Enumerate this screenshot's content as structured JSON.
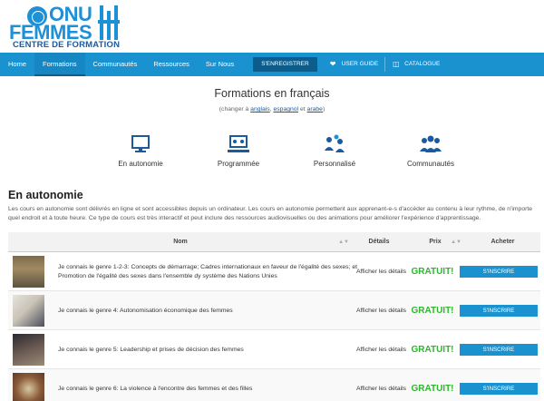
{
  "logo": {
    "line1": "ONU",
    "line2": "FEMMES",
    "sub": "CENTRE DE FORMATION"
  },
  "nav": {
    "items": [
      "Home",
      "Formations",
      "Communautés",
      "Ressources",
      "Sur Nous"
    ],
    "register": "S'ENREGISTRER",
    "user_guide": "USER GUIDE",
    "catalogue": "CATALOGUE"
  },
  "page": {
    "title": "Formations en français",
    "subtitle_prefix": "(changer à ",
    "lang1": "anglais",
    "sep1": ", ",
    "lang2": "espagnol",
    "sep2": " et ",
    "lang3": "arabe",
    "subtitle_suffix": ")"
  },
  "categories": [
    {
      "label": "En autonomie",
      "icon": "monitor-icon"
    },
    {
      "label": "Programmée",
      "icon": "presentation-icon"
    },
    {
      "label": "Personnalisé",
      "icon": "people-chat-icon"
    },
    {
      "label": "Communautés",
      "icon": "group-icon"
    }
  ],
  "section": {
    "title": "En autonomie",
    "description": "Les cours en autonomie sont délivrés en ligne et sont accessibles depuis un ordinateur. Les cours en autonomie permettent aux apprenant-e-s d'accéder au contenu à leur rythme, de n'importe quel endroit et à toute heure. Ce type de cours est très interactif et peut inclure des ressources audiovisuelles ou des animations pour améliorer l'expérience d'apprentissage."
  },
  "table": {
    "headers": {
      "name": "Nom",
      "details": "Détails",
      "price": "Prix",
      "buy": "Acheter"
    },
    "rows": [
      {
        "name": "Je connais le genre 1-2-3: Concepts de démarrage; Cadres internationaux en faveur de l'égalité des sexes; et Promotion de l'égalité des sexes dans l'ensemble dy système des Nations Unies",
        "details": "Afficher les détails",
        "price": "GRATUIT!",
        "button": "S'INSCRIRE"
      },
      {
        "name": "Je connais le genre 4: Autonomisation économique des femmes",
        "details": "Afficher les détails",
        "price": "GRATUIT!",
        "button": "S'INSCRIRE"
      },
      {
        "name": "Je connais le genre 5: Leadership et prises de décision des femmes",
        "details": "Afficher les détails",
        "price": "GRATUIT!",
        "button": "S'INSCRIRE"
      },
      {
        "name": "Je connais le genre 6: La violence à l'encontre des femmes et des filles",
        "details": "Afficher les détails",
        "price": "GRATUIT!",
        "button": "S'INSCRIRE"
      }
    ]
  },
  "colors": {
    "brand": "#1a92d0",
    "price": "#2fb52f",
    "register": "#0c5c8c"
  }
}
